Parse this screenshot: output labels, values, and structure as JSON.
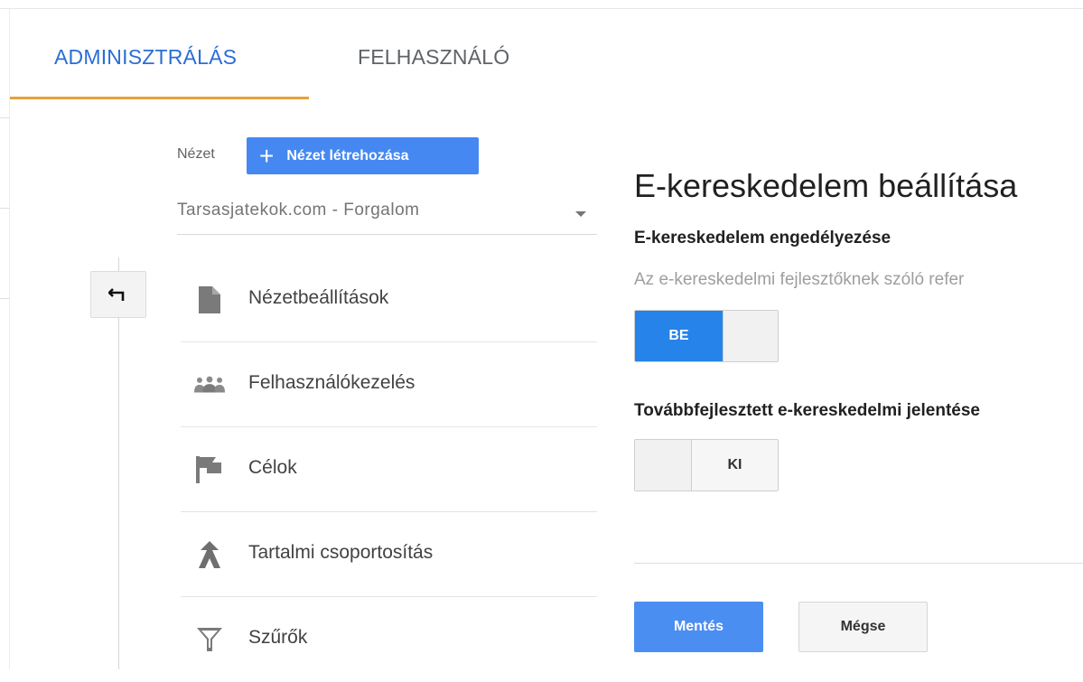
{
  "tabs": {
    "admin": "ADMINISZTRÁLÁS",
    "user": "FELHASZNÁLÓ"
  },
  "view": {
    "label": "Nézet",
    "create_button": "Nézet létrehozása",
    "selected": "Tarsasjatekok.com - Forgalom"
  },
  "menu": {
    "items": [
      {
        "label": "Nézetbeállítások",
        "icon": "document-icon"
      },
      {
        "label": "Felhasználókezelés",
        "icon": "people-icon"
      },
      {
        "label": "Célok",
        "icon": "flag-icon"
      },
      {
        "label": "Tartalmi csoportosítás",
        "icon": "merge-arrow-icon"
      },
      {
        "label": "Szűrők",
        "icon": "funnel-icon"
      }
    ]
  },
  "settings": {
    "title": "E-kereskedelem beállítása",
    "ecommerce_title": "E-kereskedelem engedélyezése",
    "ecommerce_desc": "Az e-kereskedelmi fejlesztőknek szóló refer",
    "ecommerce_toggle": "BE",
    "enhanced_title": "Továbbfejlesztett e-kereskedelmi jelentése",
    "enhanced_toggle": "KI"
  },
  "actions": {
    "save": "Mentés",
    "cancel": "Mégse"
  },
  "colors": {
    "accent": "#2a6ed6",
    "tab_underline": "#e8a23a",
    "primary_button": "#4b8ef2",
    "toggle_on": "#2583e9"
  }
}
